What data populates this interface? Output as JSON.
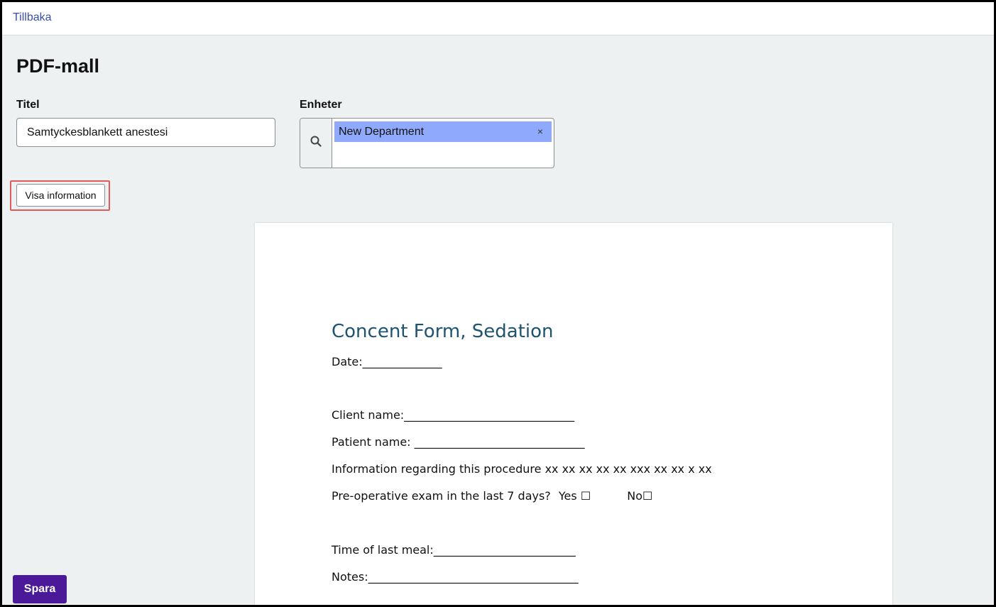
{
  "topbar": {
    "back_label": "Tillbaka"
  },
  "page": {
    "title": "PDF-mall"
  },
  "form": {
    "title_label": "Titel",
    "title_value": "Samtyckesblankett anestesi",
    "units_label": "Enheter",
    "units_selected": [
      "New Department"
    ],
    "tag_remove": "×"
  },
  "info_button_label": "Visa information",
  "document": {
    "title": "Concent Form, Sedation",
    "date_line": "Date:______________",
    "client_line": "Client name:______________________________",
    "patient_line": "Patient name: ______________________________",
    "info_line": "Information regarding this procedure xx xx xx xx xx xxx xx xx x xx",
    "preop_text": "Pre-operative exam in the last 7 days?",
    "yes_label": "Yes",
    "no_label": "No",
    "checkbox_glyph": "☐",
    "meal_line": "Time of last meal:_________________________",
    "notes_line": "Notes:_____________________________________"
  },
  "save_label": "Spara",
  "colors": {
    "accent_button": "#4a1a99",
    "tag_bg": "#8faafc",
    "doc_title": "#1f5470",
    "link": "#3a4fa8",
    "highlight": "#e05b5b"
  }
}
